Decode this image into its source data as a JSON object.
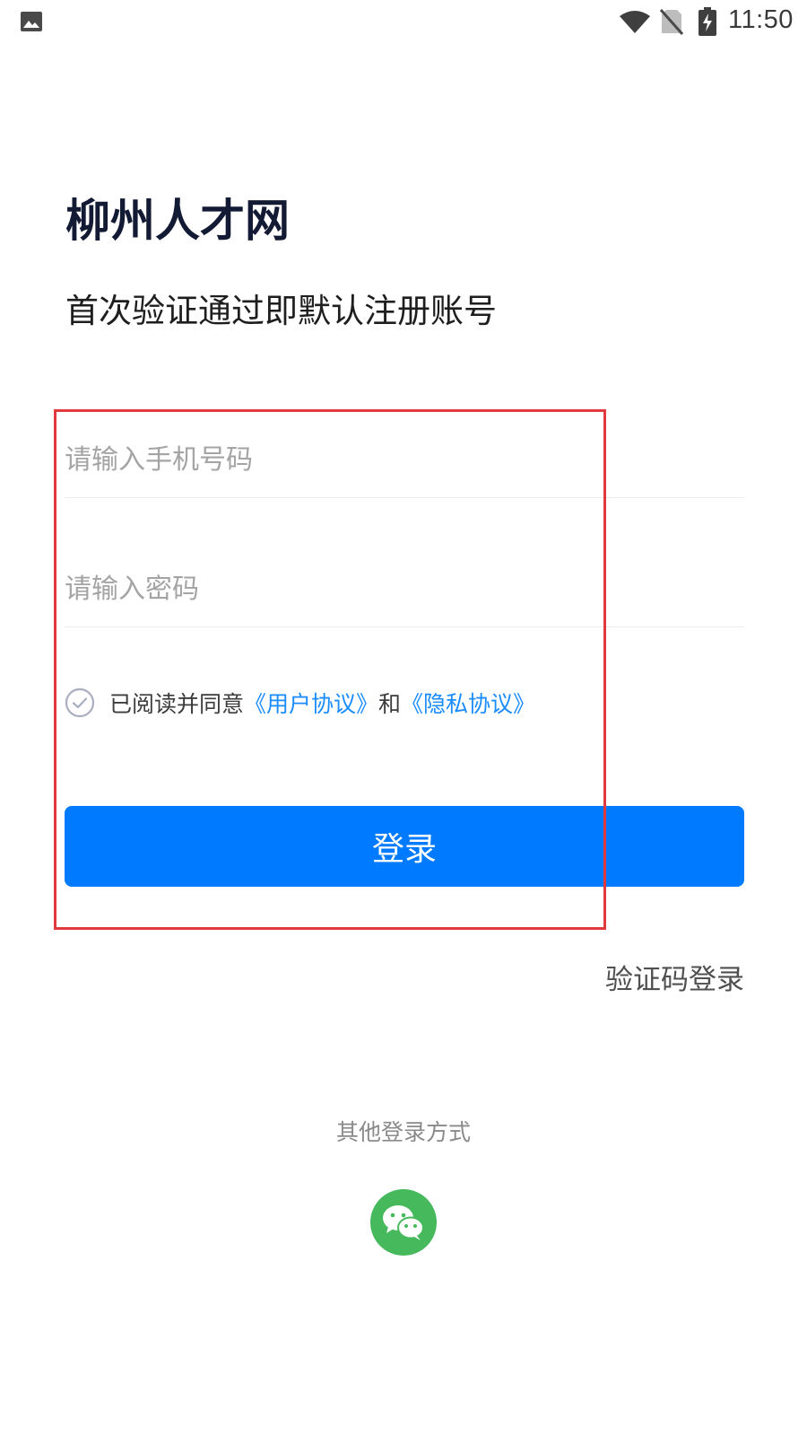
{
  "status_bar": {
    "time": "11:50",
    "icons": [
      "gallery-icon",
      "wifi-icon",
      "no-sim-icon",
      "battery-charging-icon"
    ]
  },
  "header": {
    "app_title": "柳州人才网",
    "subtitle": "首次验证通过即默认注册账号"
  },
  "form": {
    "phone_placeholder": "请输入手机号码",
    "phone_value": "",
    "password_placeholder": "请输入密码",
    "password_value": "",
    "agreement": {
      "prefix": "已阅读并同意",
      "user_agreement": "《用户协议》",
      "conjunction": "和",
      "privacy_agreement": "《隐私协议》",
      "checked": false
    },
    "login_label": "登录",
    "sms_login_label": "验证码登录"
  },
  "other_login": {
    "label": "其他登录方式",
    "methods": [
      "wechat-icon"
    ]
  },
  "colors": {
    "primary": "#007aff",
    "link": "#1a8cff",
    "wechat": "#45b95c",
    "highlight": "#e0393e"
  }
}
